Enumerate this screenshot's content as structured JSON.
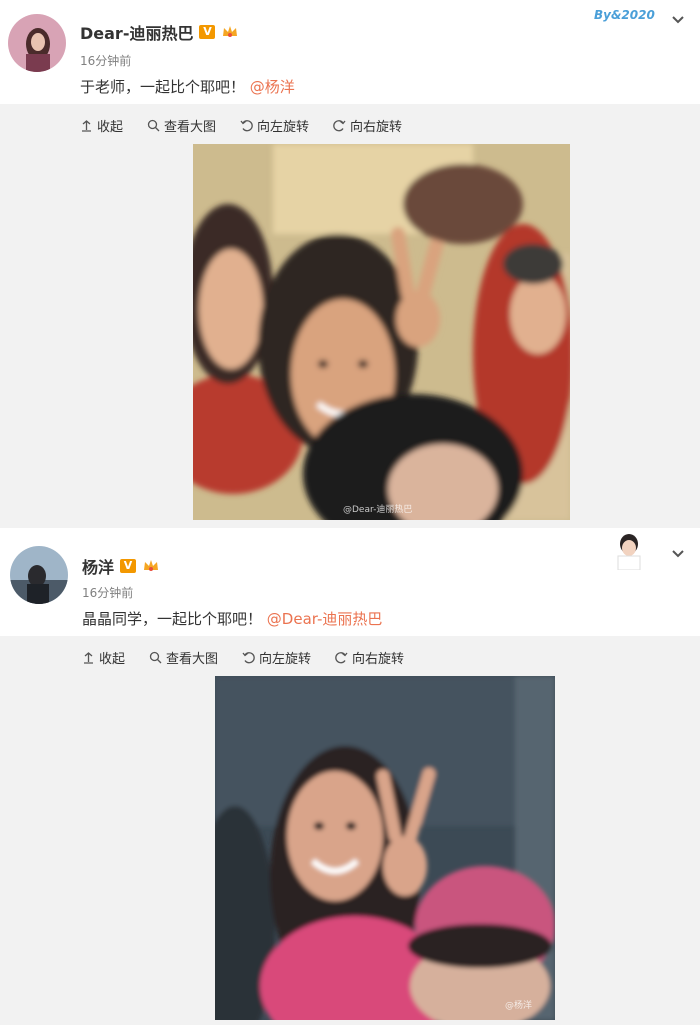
{
  "posts": [
    {
      "user": {
        "name": "Dear-迪丽热巴",
        "verified": "V"
      },
      "time": "16分钟前",
      "text": "于老师，一起比个耶吧！",
      "mention": "@杨洋",
      "decoration": "By&2020",
      "toolbar": {
        "collapse": "收起",
        "view_large": "查看大图",
        "rotate_left": "向左旋转",
        "rotate_right": "向右旋转"
      },
      "photo_watermark": "@Dear-迪丽热巴"
    },
    {
      "user": {
        "name": "杨洋",
        "verified": "V"
      },
      "time": "16分钟前",
      "text": "晶晶同学，一起比个耶吧！",
      "mention": "@Dear-迪丽热巴",
      "toolbar": {
        "collapse": "收起",
        "view_large": "查看大图",
        "rotate_left": "向左旋转",
        "rotate_right": "向右旋转"
      },
      "photo_watermark": "@杨洋"
    }
  ],
  "colors": {
    "mention": "#eb7350",
    "badge": "#f39800",
    "background": "#f2f2f2"
  },
  "icons": [
    "collapse-arrow-icon",
    "search-icon",
    "rotate-left-icon",
    "rotate-right-icon",
    "chevron-down-icon",
    "crown-icon"
  ]
}
